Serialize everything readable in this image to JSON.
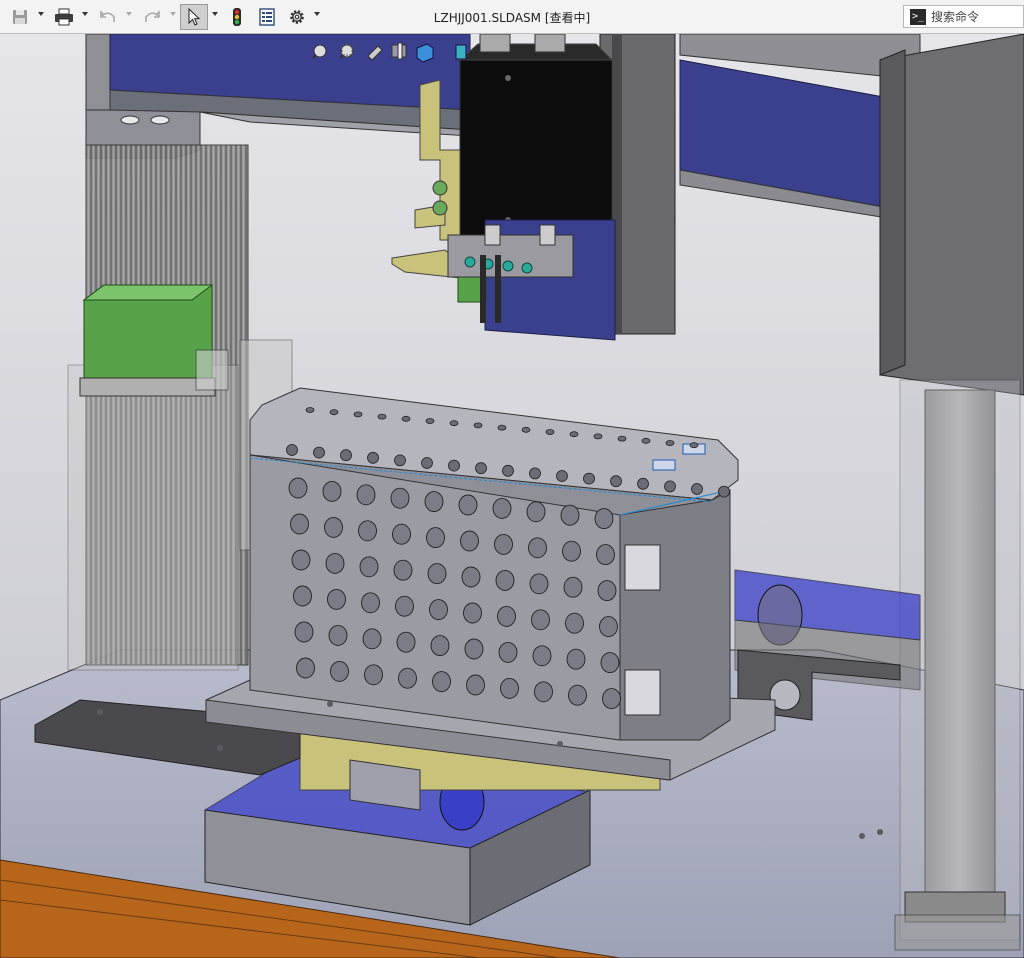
{
  "window": {
    "title": "LZHJJ001.SLDASM [查看中]"
  },
  "search": {
    "placeholder": "搜索命令",
    "icon": "command-prompt-icon"
  },
  "toolbar": {
    "icons": [
      "save-icon",
      "print-icon",
      "undo-icon",
      "redo-icon",
      "select-arrow-icon",
      "rebuild-traffic-light-icon",
      "file-properties-icon",
      "options-gear-icon"
    ]
  },
  "heads_up_toolbar": {
    "icons": [
      "zoom-to-fit-icon",
      "zoom-to-area-icon",
      "previous-view-icon",
      "section-view-icon",
      "view-orientation-icon",
      "display-style-icon"
    ]
  },
  "colors": {
    "beam_blue": "#3a3f8e",
    "block_green": "#58a34a",
    "bracket_yellow": "#c8c27a",
    "floor_orange": "#b8651c",
    "background": "#cfcfd6"
  }
}
